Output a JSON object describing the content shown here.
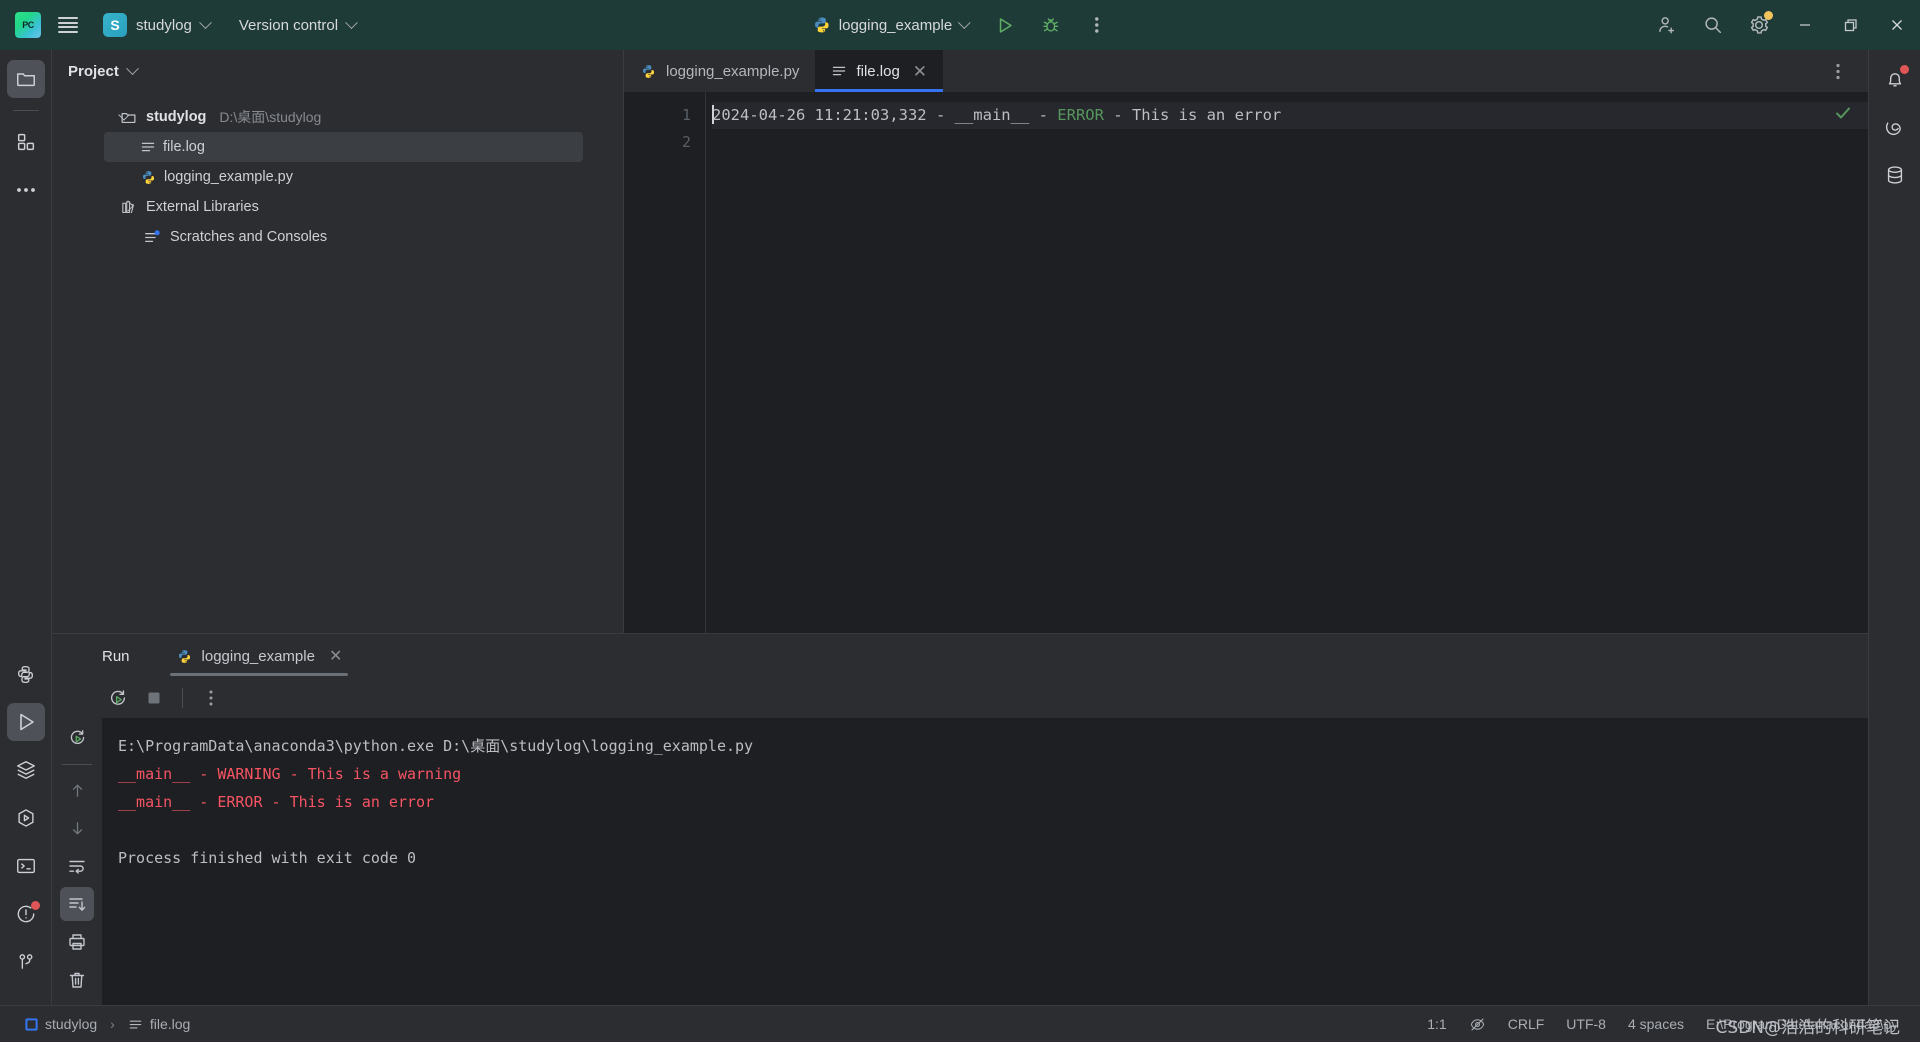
{
  "titlebar": {
    "menu_icon": "hamburger-icon",
    "app_logo": "pycharm-logo",
    "project_initial": "S",
    "project_name": "studylog",
    "version_control_label": "Version control",
    "run_config_name": "logging_example",
    "run_icon": "run-icon",
    "debug_icon": "debug-icon",
    "more_icon": "more-vertical-icon",
    "account_icon": "add-user-icon",
    "search_icon": "search-icon",
    "settings_icon": "gear-icon",
    "settings_badge_color": "#f2c55c",
    "minimize_icon": "minimize-icon",
    "maximize_icon": "maximize-icon",
    "close_icon": "close-icon",
    "background_color": "#1f3b38"
  },
  "leftbar": {
    "items": [
      {
        "name": "project-tool-button",
        "icon": "folder-icon",
        "active": true
      },
      {
        "name": "structure-tool-button",
        "icon": "squares-icon",
        "active": false
      },
      {
        "name": "more-tool-windows-button",
        "icon": "ellipsis-icon",
        "active": false
      }
    ],
    "bottom_items": [
      {
        "name": "python-packages-button",
        "icon": "python-icon",
        "active": false
      },
      {
        "name": "run-tool-button",
        "icon": "run-triangle-icon",
        "active": true
      },
      {
        "name": "python-packages-stack-button",
        "icon": "layers-icon",
        "active": false
      },
      {
        "name": "python-console-button",
        "icon": "hex-run-icon",
        "active": false
      },
      {
        "name": "terminal-button",
        "icon": "terminal-icon",
        "active": false
      },
      {
        "name": "problems-button",
        "icon": "warning-circle-icon",
        "active": false,
        "badge": "#e05555"
      },
      {
        "name": "version-control-button",
        "icon": "branch-icon",
        "active": false
      }
    ]
  },
  "rightbar": {
    "items": [
      {
        "name": "notifications-button",
        "icon": "bell-icon",
        "badge": "#e05555"
      },
      {
        "name": "ai-assistant-button",
        "icon": "spiral-icon"
      },
      {
        "name": "database-button",
        "icon": "database-icon"
      }
    ]
  },
  "project_pane": {
    "title": "Project",
    "title_chevron": "chevron-down-icon",
    "tree": [
      {
        "label": "studylog",
        "secondary": "D:\\桌面\\studylog",
        "icon": "folder-icon",
        "level": 0,
        "expanded": true,
        "selected": false,
        "type": "root"
      },
      {
        "label": "file.log",
        "icon": "log-file-icon",
        "level": 1,
        "selected": true,
        "type": "file"
      },
      {
        "label": "logging_example.py",
        "icon": "python-file-icon",
        "level": 1,
        "selected": false,
        "type": "file"
      },
      {
        "label": "External Libraries",
        "icon": "library-icon",
        "level": 0,
        "expanded": false,
        "selected": false,
        "type": "node"
      },
      {
        "label": "Scratches and Consoles",
        "icon": "scratches-icon",
        "level": 0,
        "selected": false,
        "type": "node"
      }
    ]
  },
  "editor": {
    "tabs": [
      {
        "label": "logging_example.py",
        "icon": "python-file-icon",
        "active": false,
        "closable": false
      },
      {
        "label": "file.log",
        "icon": "log-file-icon",
        "active": true,
        "closable": true
      }
    ],
    "tab_options_icon": "more-vertical-icon",
    "inspection_icon": "checkmark-icon",
    "inspection_color": "#57965c",
    "line_numbers": [
      "1",
      "2"
    ],
    "lines": [
      {
        "segments": [
          {
            "text": "2024-04-26 11:21:03,332 - __main__ - ",
            "color": "default"
          },
          {
            "text": "ERROR",
            "color": "green"
          },
          {
            "text": " - This is an error",
            "color": "default"
          }
        ]
      },
      {
        "segments": []
      }
    ]
  },
  "run_window": {
    "title": "Run",
    "tab_label": "logging_example",
    "tab_icon": "python-file-icon",
    "tab_close_icon": "close-icon",
    "toolbar": [
      {
        "name": "rerun-button",
        "icon": "rerun-icon"
      },
      {
        "name": "stop-button",
        "icon": "stop-icon"
      },
      {
        "name": "run-options-button",
        "icon": "more-vertical-icon"
      }
    ],
    "side_toolbar": [
      {
        "name": "rerun-failed-button",
        "icon": "rerun-icon",
        "active": false
      },
      {
        "name": "scroll-up-button",
        "icon": "arrow-up-icon",
        "active": false
      },
      {
        "name": "scroll-down-button",
        "icon": "arrow-down-icon",
        "active": false
      },
      {
        "name": "soft-wrap-button",
        "icon": "soft-wrap-icon",
        "active": false
      },
      {
        "name": "scroll-to-end-button",
        "icon": "scroll-to-end-icon",
        "active": true
      },
      {
        "name": "print-button",
        "icon": "printer-icon",
        "active": false
      },
      {
        "name": "clear-all-button",
        "icon": "trash-icon",
        "active": false
      }
    ],
    "console_lines": [
      {
        "text": "E:\\ProgramData\\anaconda3\\python.exe D:\\桌面\\studylog\\logging_example.py",
        "style": "default"
      },
      {
        "text": "__main__ - WARNING - This is a warning",
        "style": "error"
      },
      {
        "text": "__main__ - ERROR - This is an error",
        "style": "error"
      },
      {
        "text": "",
        "style": "default"
      },
      {
        "text": "Process finished with exit code 0",
        "style": "default"
      }
    ]
  },
  "statusbar": {
    "breadcrumbs": [
      {
        "label": "studylog",
        "icon": "module-icon"
      },
      {
        "label": "file.log",
        "icon": "log-file-icon"
      }
    ],
    "separator": "›",
    "caret_position": "1:1",
    "reader_mode_icon": "reader-mode-icon",
    "line_separator": "CRLF",
    "encoding": "UTF-8",
    "indent": "4 spaces",
    "interpreter": "E:\\ProgramData\\anaconda3\\python.exe",
    "watermark": "CSDN@浩浩的科研笔记"
  }
}
